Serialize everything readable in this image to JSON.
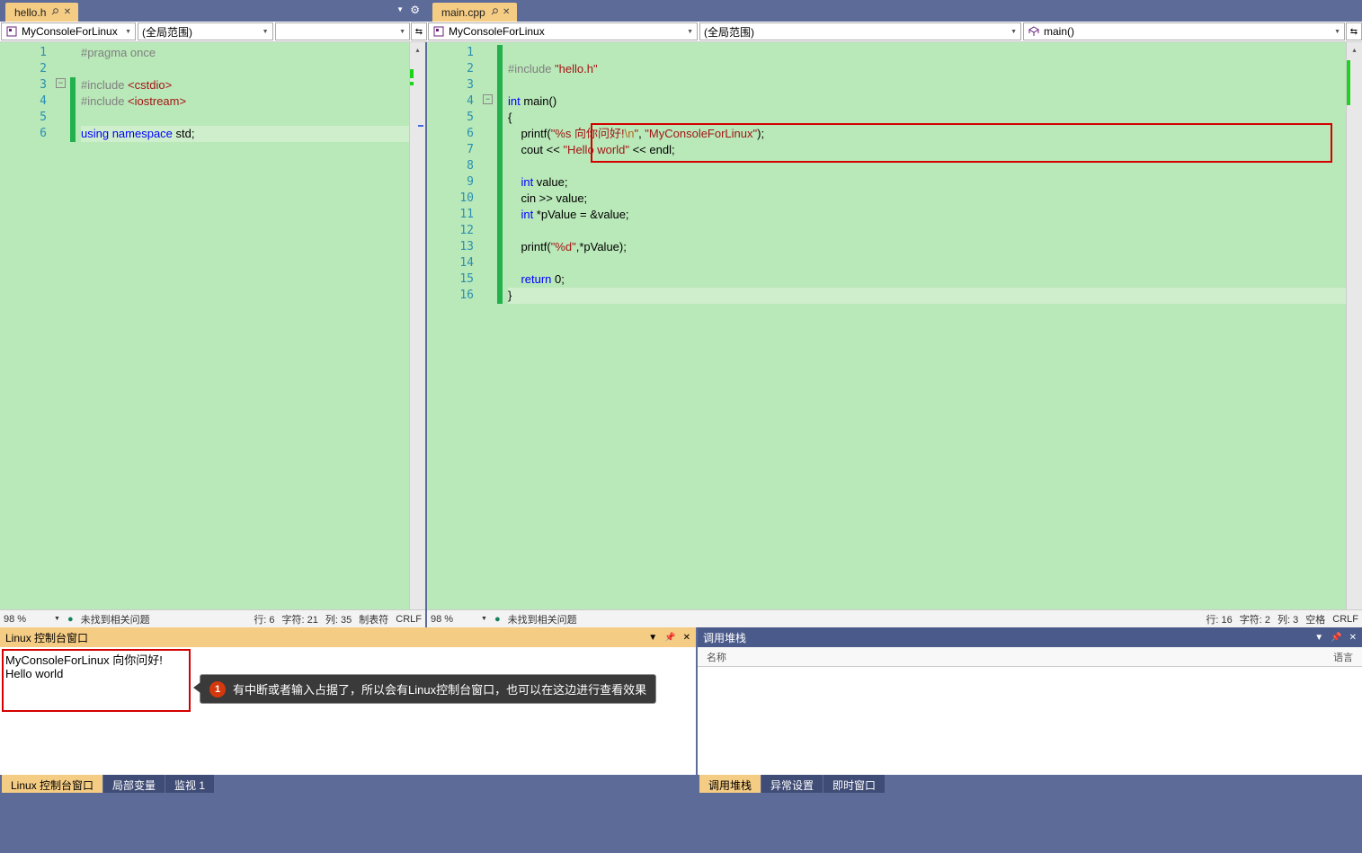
{
  "left": {
    "tab": {
      "title": "hello.h"
    },
    "nav": {
      "combo1": "MyConsoleForLinux",
      "combo2": "(全局范围)",
      "combo3": ""
    },
    "code": {
      "lines": [
        {
          "n": 1,
          "html": "<span class='dir'>#pragma once</span>"
        },
        {
          "n": 2,
          "html": ""
        },
        {
          "n": 3,
          "html": "<span class='dir'>#include </span><span class='inc'>&lt;cstdio&gt;</span>"
        },
        {
          "n": 4,
          "html": "<span class='dir'>#include </span><span class='inc'>&lt;iostream&gt;</span>"
        },
        {
          "n": 5,
          "html": ""
        },
        {
          "n": 6,
          "html": "<span class='kw'>using namespace</span> std;",
          "hl": true
        }
      ]
    },
    "status": {
      "zoom": "98 %",
      "issues": "未找到相关问题",
      "line": "行: 6",
      "char": "字符: 21",
      "col": "列: 35",
      "tabs": "制表符",
      "eol": "CRLF"
    }
  },
  "right": {
    "tab": {
      "title": "main.cpp"
    },
    "nav": {
      "combo1": "MyConsoleForLinux",
      "combo2": "(全局范围)",
      "combo3": "main()"
    },
    "code": {
      "lines": [
        {
          "n": 1,
          "html": ""
        },
        {
          "n": 2,
          "html": "<span class='dir'>#include </span><span class='inc'>\"hello.h\"</span>"
        },
        {
          "n": 3,
          "html": ""
        },
        {
          "n": 4,
          "html": "<span class='kw'>int</span> main()"
        },
        {
          "n": 5,
          "html": "{"
        },
        {
          "n": 6,
          "html": "    printf(<span class='str'>\"%s 向你问好!</span><span class='esc'>\\n</span><span class='str'>\"</span>, <span class='str'>\"MyConsoleForLinux\"</span>);"
        },
        {
          "n": 7,
          "html": "    cout &lt;&lt; <span class='str'>\"Hello world\"</span> &lt;&lt; endl;"
        },
        {
          "n": 8,
          "html": ""
        },
        {
          "n": 9,
          "html": "    <span class='kw'>int</span> value;"
        },
        {
          "n": 10,
          "html": "    cin &gt;&gt; value;"
        },
        {
          "n": 11,
          "html": "    <span class='kw'>int</span> *pValue = &amp;value;"
        },
        {
          "n": 12,
          "html": ""
        },
        {
          "n": 13,
          "html": "    printf(<span class='str'>\"%d\"</span>,*pValue);"
        },
        {
          "n": 14,
          "html": ""
        },
        {
          "n": 15,
          "html": "    <span class='kw'>return</span> 0;"
        },
        {
          "n": 16,
          "html": "}",
          "hl": true
        }
      ]
    },
    "status": {
      "zoom": "98 %",
      "issues": "未找到相关问题",
      "line": "行: 16",
      "char": "字符: 2",
      "col": "列: 3",
      "tabs": "空格",
      "eol": "CRLF"
    }
  },
  "console": {
    "title": "Linux 控制台窗口",
    "lines": [
      "MyConsoleForLinux 向你问好!",
      "Hello world"
    ],
    "annotation": {
      "num": "1",
      "text": "有中断或者输入占据了，所以会有Linux控制台窗口，也可以在这边进行查看效果"
    },
    "tabs": [
      "Linux 控制台窗口",
      "局部变量",
      "监视 1"
    ]
  },
  "callstack": {
    "title": "调用堆栈",
    "col_name": "名称",
    "col_lang": "语言",
    "tabs": [
      "调用堆栈",
      "异常设置",
      "即时窗口"
    ]
  }
}
